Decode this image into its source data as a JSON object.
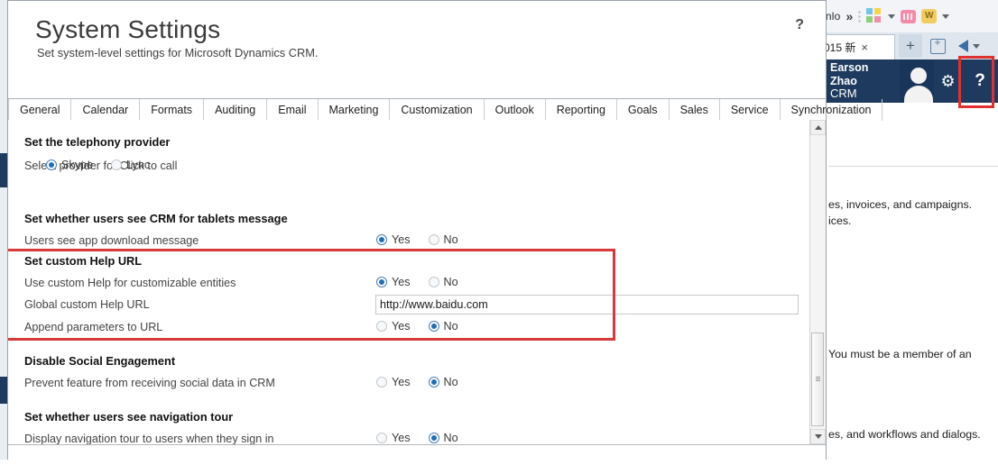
{
  "background": {
    "toolbar": {
      "download_label": "wnlo",
      "chevron_label": "»",
      "icons": [
        "grid-color-icon",
        "pink-app-icon",
        "gold-w-icon"
      ]
    },
    "tabstrip": {
      "tab_label": "015 新",
      "close_label": "×",
      "newtab_label": "+"
    },
    "crm_header": {
      "user_name": "Earson Zhao",
      "app_name": "CRM",
      "gear_label": "⚙",
      "help_label": "?"
    },
    "page_fragments": [
      "es, invoices, and campaigns.",
      "ices.",
      "You must be a member of an",
      "es, and workflows and dialogs."
    ]
  },
  "dialog": {
    "title": "System Settings",
    "subtitle": "Set system-level settings for Microsoft Dynamics CRM.",
    "help_label": "?",
    "tabs": [
      {
        "label": "General",
        "active": true
      },
      {
        "label": "Calendar",
        "active": false
      },
      {
        "label": "Formats",
        "active": false
      },
      {
        "label": "Auditing",
        "active": false
      },
      {
        "label": "Email",
        "active": false
      },
      {
        "label": "Marketing",
        "active": false
      },
      {
        "label": "Customization",
        "active": false
      },
      {
        "label": "Outlook",
        "active": false
      },
      {
        "label": "Reporting",
        "active": false
      },
      {
        "label": "Goals",
        "active": false
      },
      {
        "label": "Sales",
        "active": false
      },
      {
        "label": "Service",
        "active": false
      },
      {
        "label": "Synchronization",
        "active": false
      }
    ],
    "sections": [
      {
        "title": "Set the telephony provider",
        "rows": [
          {
            "label": "Select provider for Click to call",
            "type": "radio-inline",
            "options": [
              {
                "label": "Skype",
                "selected": true
              },
              {
                "label": "Lync",
                "selected": false
              }
            ]
          }
        ]
      },
      {
        "title": "Set whether users see CRM for tablets message",
        "rows": [
          {
            "label": "Users see app download message",
            "type": "radio-yesno",
            "options": [
              {
                "label": "Yes",
                "selected": true
              },
              {
                "label": "No",
                "selected": false
              }
            ]
          }
        ]
      },
      {
        "title": "Set custom Help URL",
        "highlighted": true,
        "rows": [
          {
            "label": "Use custom Help for customizable entities",
            "type": "radio-yesno",
            "options": [
              {
                "label": "Yes",
                "selected": true
              },
              {
                "label": "No",
                "selected": false
              }
            ]
          },
          {
            "label": "Global custom Help URL",
            "type": "text",
            "value": "http://www.baidu.com",
            "placeholder": ""
          },
          {
            "label": "Append parameters to URL",
            "type": "radio-yesno",
            "options": [
              {
                "label": "Yes",
                "selected": false
              },
              {
                "label": "No",
                "selected": true
              }
            ]
          }
        ]
      },
      {
        "title": "Disable Social Engagement",
        "rows": [
          {
            "label": "Prevent feature from receiving social data in CRM",
            "type": "radio-yesno",
            "options": [
              {
                "label": "Yes",
                "selected": false
              },
              {
                "label": "No",
                "selected": true
              }
            ]
          }
        ]
      },
      {
        "title": "Set whether users see navigation tour",
        "rows": [
          {
            "label": "Display navigation tour to users when they sign in",
            "type": "radio-yesno",
            "options": [
              {
                "label": "Yes",
                "selected": false
              },
              {
                "label": "No",
                "selected": true
              }
            ]
          }
        ]
      }
    ],
    "scrollbar": {
      "up_arrow": "▲",
      "down_arrow": "▼"
    }
  },
  "colors": {
    "highlight": "#d83a3a",
    "crm_bar": "#1e3a5f",
    "radio_selected": "#1f6fb8"
  }
}
